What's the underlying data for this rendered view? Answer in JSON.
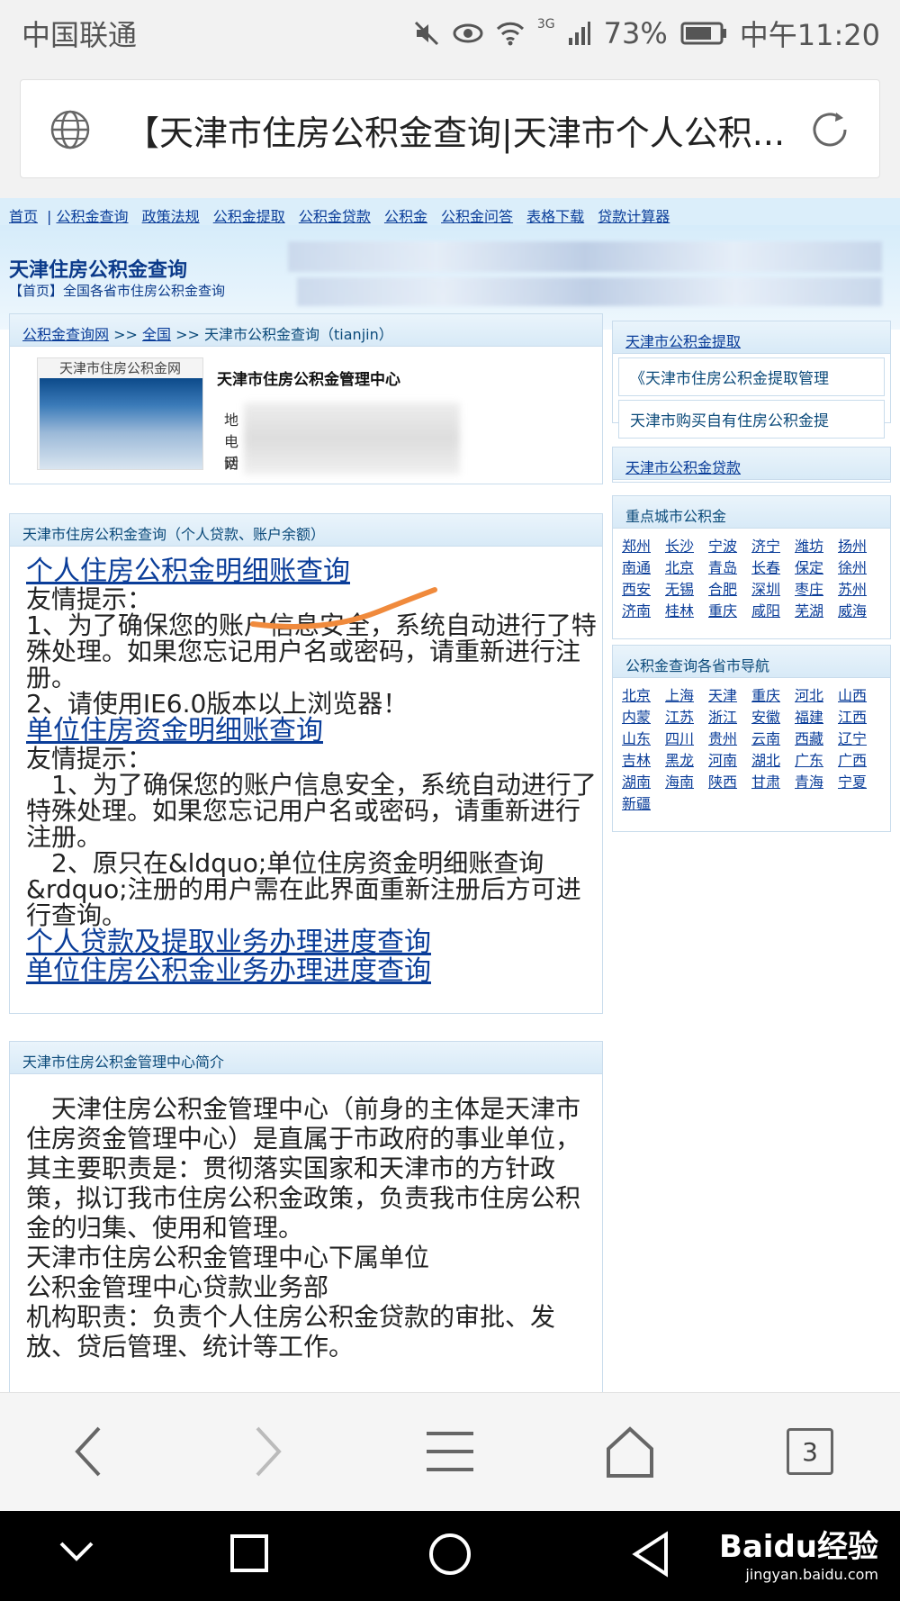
{
  "status": {
    "carrier": "中国联通",
    "battery": "73%",
    "time": "中午11:20",
    "net": "3G"
  },
  "address": {
    "title": "【天津市住房公积金查询|天津市个人公积..."
  },
  "topnav": [
    "首页",
    "公积金查询",
    "政策法规",
    "公积金提取",
    "公积金贷款",
    "公积金",
    "公积金问答",
    "表格下载",
    "贷款计算器"
  ],
  "banner": {
    "title": "天津住房公积金查询",
    "subtitle": "【首页】全国各省市住房公积金查询"
  },
  "crumb": {
    "home": "公积金查询网",
    "sep1": ">>",
    "all": "全国",
    "sep2": ">>",
    "current": "天津市公积金查询（tianjin）"
  },
  "card": {
    "thumb_caption": "天津市住房公积金网",
    "name": "天津市住房公积金管理中心",
    "l1": "地",
    "l2": "电话",
    "l3": "网"
  },
  "query": {
    "header": "天津市住房公积金查询（个人贷款、账户余额）",
    "link1": "个人住房公积金明细账查询",
    "tip1": "友情提示：",
    "p1": "1、为了确保您的账户信息安全，系统自动进行了特殊处理。如果您忘记用户名或密码，请重新进行注册。",
    "p2": "2、请使用IE6.0版本以上浏览器！",
    "link2": "单位住房资金明细账查询",
    "tip2": "友情提示：",
    "p3": "　1、为了确保您的账户信息安全，系统自动进行了特殊处理。如果您忘记用户名或密码，请重新进行注册。",
    "p4": "　2、原只在&ldquo;单位住房资金明细账查询&rdquo;注册的用户需在此界面重新注册后方可进行查询。",
    "link3": "个人贷款及提取业务办理进度查询",
    "link4": "单位住房公积金业务办理进度查询"
  },
  "intro": {
    "header": "天津市住房公积金管理中心简介",
    "p1": "　天津住房公积金管理中心（前身的主体是天津市住房资金管理中心）是直属于市政府的事业单位，其主要职责是：贯彻落实国家和天津市的方针政策，拟订我市住房公积金政策，负责我市住房公积金的归集、使用和管理。",
    "p2": "天津市住房公积金管理中心下属单位",
    "p3": "公积金管理中心贷款业务部",
    "p4": "机构职责：负责个人住房公积金贷款的审批、发放、贷后管理、统计等工作。"
  },
  "side": {
    "withdraw_header": "天津市公积金提取",
    "withdraw_items": [
      "《天津市住房公积金提取管理",
      "天津市购买自有住房公积金提"
    ],
    "loan_header": "天津市公积金贷款",
    "cities_header": "重点城市公积金",
    "cities": [
      "郑州",
      "长沙",
      "宁波",
      "济宁",
      "潍坊",
      "扬州",
      "南通",
      "北京",
      "青岛",
      "长春",
      "保定",
      "徐州",
      "西安",
      "无锡",
      "合肥",
      "深圳",
      "枣庄",
      "苏州",
      "济南",
      "桂林",
      "重庆",
      "咸阳",
      "芜湖",
      "威海"
    ],
    "provinces_header": "公积金查询各省市导航",
    "provinces": [
      "北京",
      "上海",
      "天津",
      "重庆",
      "河北",
      "山西",
      "内蒙",
      "江苏",
      "浙江",
      "安徽",
      "福建",
      "江西",
      "山东",
      "四川",
      "贵州",
      "云南",
      "西藏",
      "辽宁",
      "吉林",
      "黑龙",
      "河南",
      "湖北",
      "广东",
      "广西",
      "湖南",
      "海南",
      "陕西",
      "甘肃",
      "青海",
      "宁夏",
      "新疆"
    ]
  },
  "bottomnav": {
    "tabs": "3"
  },
  "watermark": {
    "brand": "Baidu经验",
    "url": "jingyan.baidu.com"
  }
}
